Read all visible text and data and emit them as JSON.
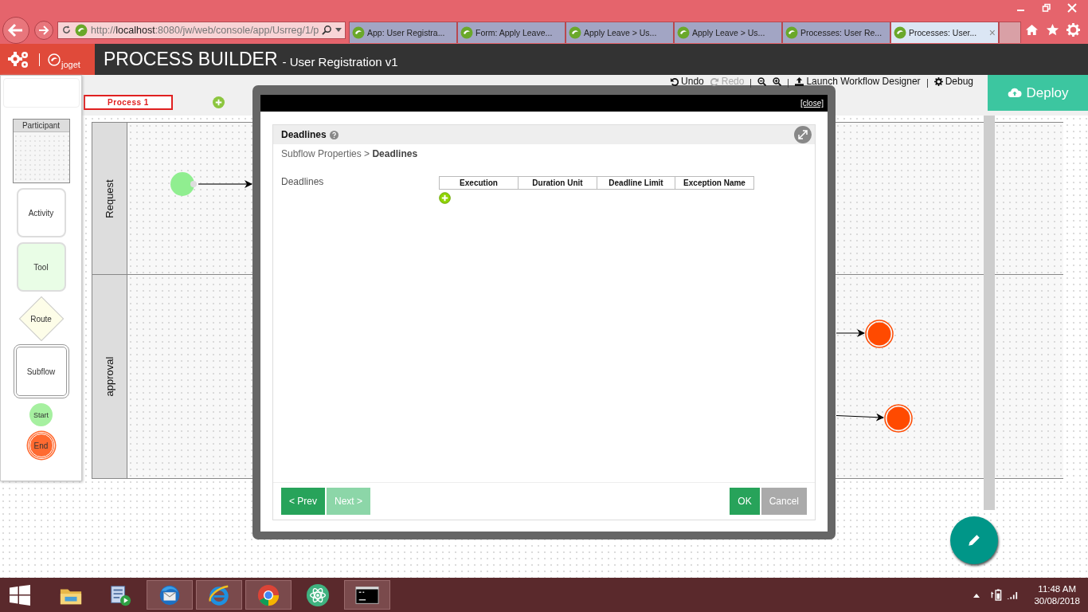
{
  "browser": {
    "address": "http://**localhost**:8080/jw/web/console/app/Usrreg/1/p",
    "tabs": [
      {
        "title": "App: User Registra...",
        "selected": false
      },
      {
        "title": "Form: Apply Leave...",
        "selected": false
      },
      {
        "title": "Apply Leave  >  Us...",
        "selected": false
      },
      {
        "title": "Apply Leave  >  Us...",
        "selected": false
      },
      {
        "title": "Processes: User Re...",
        "selected": false
      },
      {
        "title": "Processes: User...",
        "selected": true
      }
    ],
    "close_tab": "×"
  },
  "app": {
    "logo": "joget",
    "title": "PROCESS BUILDER",
    "subtitle": "- User Registration v1"
  },
  "toolbar": [
    {
      "kind": "undo",
      "label": "Undo",
      "disabled": false
    },
    {
      "kind": "redo",
      "label": "Redo",
      "disabled": true
    },
    {
      "kind": "zoom_out",
      "disabled": false
    },
    {
      "kind": "zoom_in",
      "disabled": false
    },
    {
      "kind": "launch",
      "label": "Launch Workflow Designer",
      "disabled": false
    },
    {
      "kind": "debug",
      "label": "Debug",
      "disabled": false
    }
  ],
  "deploy": "Deploy",
  "palette": [
    {
      "kind": "participant",
      "label": "Participant"
    },
    {
      "kind": "activity",
      "label": "Activity"
    },
    {
      "kind": "tool",
      "label": "Tool"
    },
    {
      "kind": "route",
      "label": "Route"
    },
    {
      "kind": "subflow",
      "label": "Subflow"
    },
    {
      "kind": "start",
      "label": "Start"
    },
    {
      "kind": "end",
      "label": "End"
    }
  ],
  "process_tabs": [
    {
      "label": "Process 1",
      "selected": true
    }
  ],
  "lanes": [
    {
      "label": "Request"
    },
    {
      "label": "approval"
    }
  ],
  "dialog": {
    "close": "[close]",
    "title": "Deadlines",
    "breadcrumb": "Subflow Properties > **Deadlines**",
    "field_label": "Deadlines",
    "columns": [
      "Execution",
      "Duration Unit",
      "Deadline Limit",
      "Exception Name"
    ],
    "buttons": [
      {
        "label": "< Prev",
        "kind": "nav",
        "disabled": false
      },
      {
        "label": "Next >",
        "kind": "nav",
        "disabled": true
      },
      {
        "label": "OK",
        "kind": "ok",
        "disabled": false
      },
      {
        "label": "Cancel",
        "kind": "cancel",
        "disabled": false
      }
    ]
  },
  "taskbar": {
    "apps": [
      {
        "kind": "folder",
        "running": false
      },
      {
        "kind": "media",
        "running": false
      },
      {
        "kind": "mail",
        "running": true
      },
      {
        "kind": "ie",
        "running": true
      },
      {
        "kind": "chrome",
        "running": true
      },
      {
        "kind": "atom",
        "running": false
      },
      {
        "kind": "cmd",
        "running": true
      }
    ],
    "time": "11:48 AM",
    "date": "30/08/2018"
  }
}
